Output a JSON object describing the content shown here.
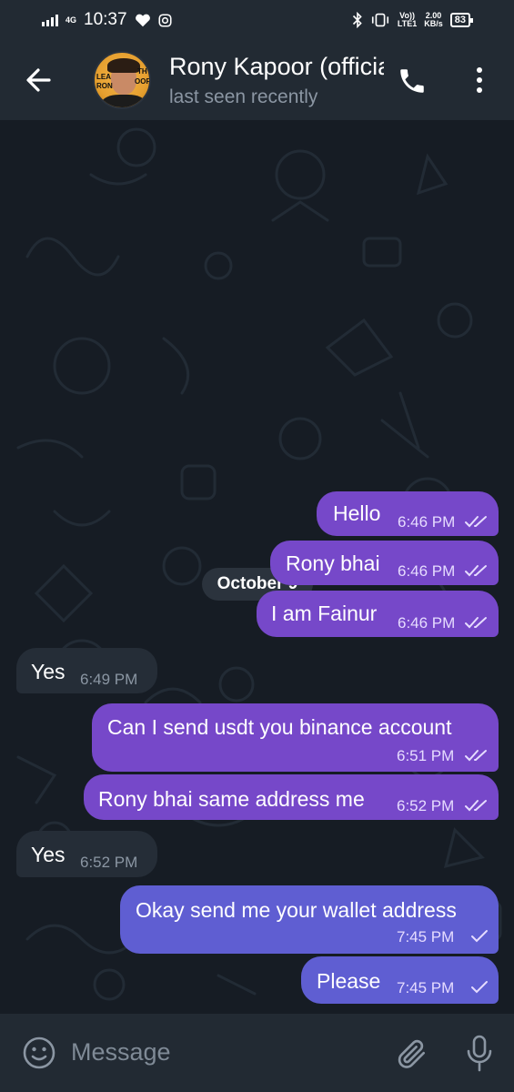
{
  "status_bar": {
    "network": "4G",
    "time": "10:37",
    "volte_top": "Vo))",
    "volte_bottom": "LTE1",
    "speed_value": "2.00",
    "speed_unit": "KB/s",
    "battery": "83"
  },
  "header": {
    "contact_name": "Rony Kapoor (official)",
    "status": "last seen recently",
    "avatar_text_left": "LEA",
    "avatar_text_left2": "RON",
    "avatar_text_right": "TH",
    "avatar_text_right2": "OOR"
  },
  "chat": {
    "date_label": "October 9",
    "messages": [
      {
        "dir": "out",
        "text": "Hello",
        "time": "6:46 PM",
        "status": "read"
      },
      {
        "dir": "out",
        "text": "Rony bhai",
        "time": "6:46 PM",
        "status": "read"
      },
      {
        "dir": "out",
        "text": "I am Fainur",
        "time": "6:46 PM",
        "status": "read"
      },
      {
        "dir": "in",
        "text": "Yes",
        "time": "6:49 PM"
      },
      {
        "dir": "out",
        "text": "Can I send usdt you binance account",
        "time": "6:51 PM",
        "status": "read"
      },
      {
        "dir": "out",
        "text": "Rony bhai same address me",
        "time": "6:52 PM",
        "status": "read"
      },
      {
        "dir": "in",
        "text": "Yes",
        "time": "6:52 PM"
      },
      {
        "dir": "out",
        "text": "Okay send me your wallet address",
        "time": "7:45 PM",
        "status": "sent"
      },
      {
        "dir": "out",
        "text": "Please",
        "time": "7:45 PM",
        "status": "sent"
      }
    ]
  },
  "input": {
    "placeholder": "Message",
    "value": ""
  },
  "colors": {
    "background": "#161c24",
    "bar": "#222a33",
    "outgoing_bubble": "#7648c9",
    "outgoing_bubble_recent": "#5f5ed2",
    "incoming_bubble": "#252d37",
    "muted_text": "#8b96a3"
  },
  "icons": {
    "back": "arrow-left-icon",
    "call": "phone-icon",
    "menu": "more-vertical-icon",
    "emoji": "smiley-icon",
    "attach": "paperclip-icon",
    "mic": "microphone-icon",
    "read": "double-check-icon",
    "sent": "single-check-icon"
  }
}
